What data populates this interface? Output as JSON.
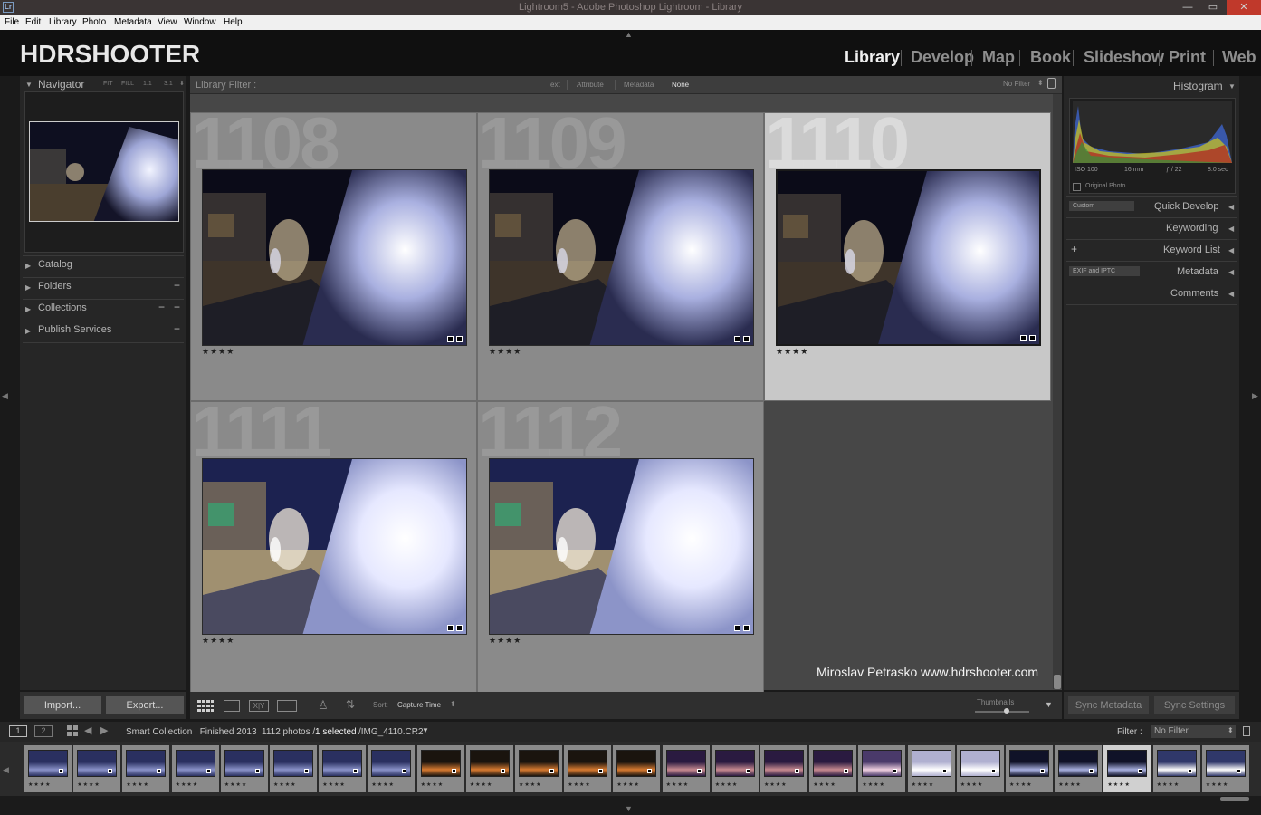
{
  "window": {
    "title": "Lightroom5 - Adobe Photoshop Lightroom - Library",
    "app_icon": "Lr"
  },
  "menu": [
    "File",
    "Edit",
    "Library",
    "Photo",
    "Metadata",
    "View",
    "Window",
    "Help"
  ],
  "identity_plate": "HDRSHOOTER",
  "modules": [
    "Library",
    "Develop",
    "Map",
    "Book",
    "Slideshow",
    "Print",
    "Web"
  ],
  "active_module": "Library",
  "left_panel": {
    "navigator": {
      "title": "Navigator",
      "zoom": [
        "FIT",
        "FILL",
        "1:1",
        "3:1"
      ]
    },
    "sections": [
      {
        "label": "Catalog",
        "actions": []
      },
      {
        "label": "Folders",
        "actions": [
          "+"
        ]
      },
      {
        "label": "Collections",
        "actions": [
          "−",
          "+"
        ]
      },
      {
        "label": "Publish Services",
        "actions": [
          "+"
        ]
      }
    ],
    "import_label": "Import...",
    "export_label": "Export..."
  },
  "filter_bar": {
    "label": "Library Filter :",
    "options": [
      "Text",
      "Attribute",
      "Metadata",
      "None"
    ],
    "active": "None",
    "preset": "No Filter"
  },
  "grid": {
    "cells": [
      {
        "number": "1108",
        "stars": "★★★★",
        "tone": "dark",
        "selected": false
      },
      {
        "number": "1109",
        "stars": "★★★★",
        "tone": "dark",
        "selected": false
      },
      {
        "number": "1110",
        "stars": "★★★★",
        "tone": "dark",
        "selected": true
      },
      {
        "number": "1111",
        "stars": "★★★★",
        "tone": "bright",
        "selected": false
      },
      {
        "number": "1112",
        "stars": "★★★★",
        "tone": "bright",
        "selected": false
      }
    ],
    "watermark": "Miroslav  Petrasko  www.hdrshooter.com"
  },
  "toolbar": {
    "sort_label": "Sort:",
    "sort_value": "Capture Time",
    "thumbnails_label": "Thumbnails",
    "thumbnail_size": 0.6
  },
  "right_panel": {
    "histogram": {
      "title": "Histogram",
      "iso": "ISO 100",
      "focal": "16 mm",
      "aperture": "ƒ / 22",
      "shutter": "8.0 sec",
      "original_photo": "Original Photo"
    },
    "sections": [
      "Quick Develop",
      "Keywording",
      "Keyword List",
      "Metadata",
      "Comments"
    ],
    "quick_develop_preset": "Custom",
    "metadata_preset": "EXIF and IPTC",
    "keyword_add": "+",
    "sync_metadata": "Sync Metadata",
    "sync_settings": "Sync Settings"
  },
  "filmstrip": {
    "screen1": "1",
    "screen2": "2",
    "source": "Smart Collection : Finished 2013",
    "count": "1112 photos /",
    "selected": "1 selected",
    "file": "/IMG_4110.CR2",
    "filter_label": "Filter :",
    "filter_value": "No Filter",
    "thumb_stars": "★★★★",
    "thumbs": [
      "blue",
      "blue",
      "blue",
      "blue",
      "blue",
      "blue",
      "blue",
      "blue",
      "sunset",
      "sunset",
      "sunset",
      "sunset",
      "sunset",
      "dusk",
      "dusk",
      "dusk",
      "dusk",
      "pink",
      "white",
      "white",
      "night",
      "night",
      "night",
      "bright",
      "bright"
    ],
    "selected_index": 22
  }
}
